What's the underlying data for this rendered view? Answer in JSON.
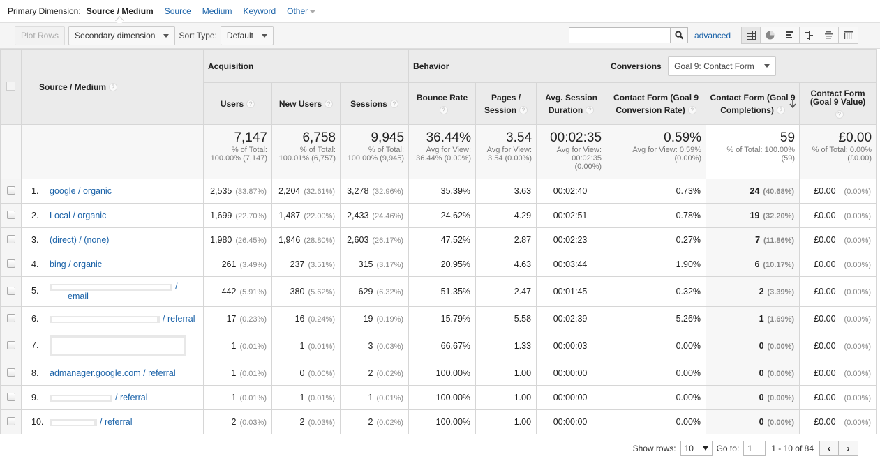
{
  "dimension_bar": {
    "label": "Primary Dimension:",
    "active": "Source / Medium",
    "options": [
      "Source",
      "Medium",
      "Keyword",
      "Other"
    ]
  },
  "toolbar": {
    "plot_rows": "Plot Rows",
    "secondary_dimension": "Secondary dimension",
    "sort_type_label": "Sort Type:",
    "sort_type_value": "Default",
    "search_value": "",
    "advanced": "advanced",
    "view_icons": [
      "table-view-icon",
      "pie-view-icon",
      "bar-performance-icon",
      "comparison-icon",
      "term-cloud-icon",
      "pivot-icon"
    ]
  },
  "table": {
    "dimension_header": "Source / Medium",
    "groups": {
      "acquisition": "Acquisition",
      "behavior": "Behavior",
      "conversions": "Conversions",
      "goal_select": "Goal 9: Contact Form"
    },
    "columns": {
      "users": "Users",
      "new_users": "New Users",
      "sessions": "Sessions",
      "bounce_rate": "Bounce Rate",
      "pages_session_1": "Pages /",
      "pages_session_2": "Session",
      "avg_dur_1": "Avg. Session",
      "avg_dur_2": "Duration",
      "conv_rate_1": "Contact Form (Goal 9",
      "conv_rate_2": "Conversion Rate)",
      "completions_1": "Contact Form (Goal 9",
      "completions_2": "Completions)",
      "value_1": "Contact Form",
      "value_2": "(Goal 9 Value)"
    },
    "totals": {
      "users": {
        "value": "7,147",
        "line1": "% of Total:",
        "line2": "100.00% (7,147)"
      },
      "new_users": {
        "value": "6,758",
        "line1": "% of Total:",
        "line2": "100.01% (6,757)"
      },
      "sessions": {
        "value": "9,945",
        "line1": "% of Total:",
        "line2": "100.00% (9,945)"
      },
      "bounce_rate": {
        "value": "36.44%",
        "line1": "Avg for View:",
        "line2": "36.44% (0.00%)"
      },
      "pages_session": {
        "value": "3.54",
        "line1": "Avg for View:",
        "line2": "3.54 (0.00%)"
      },
      "avg_duration": {
        "value": "00:02:35",
        "line1": "Avg for View:",
        "line2": "00:02:35",
        "line3": "(0.00%)"
      },
      "conv_rate": {
        "value": "0.59%",
        "line1": "Avg for View: 0.59%",
        "line2": "(0.00%)"
      },
      "completions": {
        "value": "59",
        "line1": "% of Total: 100.00%",
        "line2": "(59)"
      },
      "goal_value": {
        "value": "£0.00",
        "line1": "% of Total: 0.00%",
        "line2": "(£0.00)"
      }
    },
    "rows": [
      {
        "num": "1.",
        "dim": "google / organic",
        "users": "2,535",
        "users_pct": "(33.87%)",
        "new_users": "2,204",
        "new_users_pct": "(32.61%)",
        "sessions": "3,278",
        "sessions_pct": "(32.96%)",
        "bounce": "35.39%",
        "pps": "3.63",
        "dur": "00:02:40",
        "conv": "0.73%",
        "comp": "24",
        "comp_pct": "(40.68%)",
        "val": "£0.00",
        "val_pct": "(0.00%)"
      },
      {
        "num": "2.",
        "dim": "Local / organic",
        "users": "1,699",
        "users_pct": "(22.70%)",
        "new_users": "1,487",
        "new_users_pct": "(22.00%)",
        "sessions": "2,433",
        "sessions_pct": "(24.46%)",
        "bounce": "24.62%",
        "pps": "4.29",
        "dur": "00:02:51",
        "conv": "0.78%",
        "comp": "19",
        "comp_pct": "(32.20%)",
        "val": "£0.00",
        "val_pct": "(0.00%)"
      },
      {
        "num": "3.",
        "dim": "(direct) / (none)",
        "users": "1,980",
        "users_pct": "(26.45%)",
        "new_users": "1,946",
        "new_users_pct": "(28.80%)",
        "sessions": "2,603",
        "sessions_pct": "(26.17%)",
        "bounce": "47.52%",
        "pps": "2.87",
        "dur": "00:02:23",
        "conv": "0.27%",
        "comp": "7",
        "comp_pct": "(11.86%)",
        "val": "£0.00",
        "val_pct": "(0.00%)"
      },
      {
        "num": "4.",
        "dim": "bing / organic",
        "users": "261",
        "users_pct": "(3.49%)",
        "new_users": "237",
        "new_users_pct": "(3.51%)",
        "sessions": "315",
        "sessions_pct": "(3.17%)",
        "bounce": "20.95%",
        "pps": "4.63",
        "dur": "00:03:44",
        "conv": "1.90%",
        "comp": "6",
        "comp_pct": "(10.17%)",
        "val": "£0.00",
        "val_pct": "(0.00%)"
      },
      {
        "num": "5.",
        "dim_suffix": "/",
        "dim_line2": "email",
        "users": "442",
        "users_pct": "(5.91%)",
        "new_users": "380",
        "new_users_pct": "(5.62%)",
        "sessions": "629",
        "sessions_pct": "(6.32%)",
        "bounce": "51.35%",
        "pps": "2.47",
        "dur": "00:01:45",
        "conv": "0.32%",
        "comp": "2",
        "comp_pct": "(3.39%)",
        "val": "£0.00",
        "val_pct": "(0.00%)"
      },
      {
        "num": "6.",
        "dim_suffix": "/ referral",
        "users": "17",
        "users_pct": "(0.23%)",
        "new_users": "16",
        "new_users_pct": "(0.24%)",
        "sessions": "19",
        "sessions_pct": "(0.19%)",
        "bounce": "15.79%",
        "pps": "5.58",
        "dur": "00:02:39",
        "conv": "5.26%",
        "comp": "1",
        "comp_pct": "(1.69%)",
        "val": "£0.00",
        "val_pct": "(0.00%)"
      },
      {
        "num": "7.",
        "users": "1",
        "users_pct": "(0.01%)",
        "new_users": "1",
        "new_users_pct": "(0.01%)",
        "sessions": "3",
        "sessions_pct": "(0.03%)",
        "bounce": "66.67%",
        "pps": "1.33",
        "dur": "00:00:03",
        "conv": "0.00%",
        "comp": "0",
        "comp_pct": "(0.00%)",
        "val": "£0.00",
        "val_pct": "(0.00%)"
      },
      {
        "num": "8.",
        "dim": "admanager.google.com / referral",
        "users": "1",
        "users_pct": "(0.01%)",
        "new_users": "0",
        "new_users_pct": "(0.00%)",
        "sessions": "2",
        "sessions_pct": "(0.02%)",
        "bounce": "100.00%",
        "pps": "1.00",
        "dur": "00:00:00",
        "conv": "0.00%",
        "comp": "0",
        "comp_pct": "(0.00%)",
        "val": "£0.00",
        "val_pct": "(0.00%)"
      },
      {
        "num": "9.",
        "dim_suffix": "/ referral",
        "users": "1",
        "users_pct": "(0.01%)",
        "new_users": "1",
        "new_users_pct": "(0.01%)",
        "sessions": "1",
        "sessions_pct": "(0.01%)",
        "bounce": "100.00%",
        "pps": "1.00",
        "dur": "00:00:00",
        "conv": "0.00%",
        "comp": "0",
        "comp_pct": "(0.00%)",
        "val": "£0.00",
        "val_pct": "(0.00%)"
      },
      {
        "num": "10.",
        "dim_suffix": "/ referral",
        "users": "2",
        "users_pct": "(0.03%)",
        "new_users": "2",
        "new_users_pct": "(0.03%)",
        "sessions": "2",
        "sessions_pct": "(0.02%)",
        "bounce": "100.00%",
        "pps": "1.00",
        "dur": "00:00:00",
        "conv": "0.00%",
        "comp": "0",
        "comp_pct": "(0.00%)",
        "val": "£0.00",
        "val_pct": "(0.00%)"
      }
    ]
  },
  "footer": {
    "show_rows_label": "Show rows:",
    "show_rows_value": "10",
    "goto_label": "Go to:",
    "goto_value": "1",
    "range": "1 - 10 of 84",
    "prev": "‹",
    "next": "›"
  }
}
